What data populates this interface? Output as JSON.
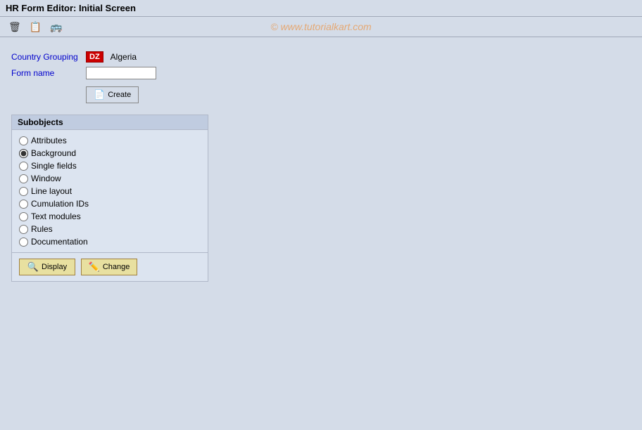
{
  "title_bar": {
    "label": "HR Form Editor: Initial Screen"
  },
  "toolbar": {
    "watermark": "© www.tutorialkart.com",
    "buttons": [
      {
        "name": "delete",
        "icon": "🗑"
      },
      {
        "name": "copy",
        "icon": "📋"
      },
      {
        "name": "transport",
        "icon": "🚚"
      }
    ]
  },
  "form": {
    "country_grouping_label": "Country Grouping",
    "country_grouping_value": "DZ",
    "country_name": "Algeria",
    "form_name_label": "Form name",
    "form_name_placeholder": "",
    "create_button": "Create"
  },
  "subobjects": {
    "header": "Subobjects",
    "items": [
      {
        "label": "Attributes",
        "selected": false
      },
      {
        "label": "Background",
        "selected": true
      },
      {
        "label": "Single fields",
        "selected": false
      },
      {
        "label": "Window",
        "selected": false
      },
      {
        "label": "Line layout",
        "selected": false
      },
      {
        "label": "Cumulation IDs",
        "selected": false
      },
      {
        "label": "Text modules",
        "selected": false
      },
      {
        "label": "Rules",
        "selected": false
      },
      {
        "label": "Documentation",
        "selected": false
      }
    ],
    "display_button": "Display",
    "change_button": "Change"
  }
}
